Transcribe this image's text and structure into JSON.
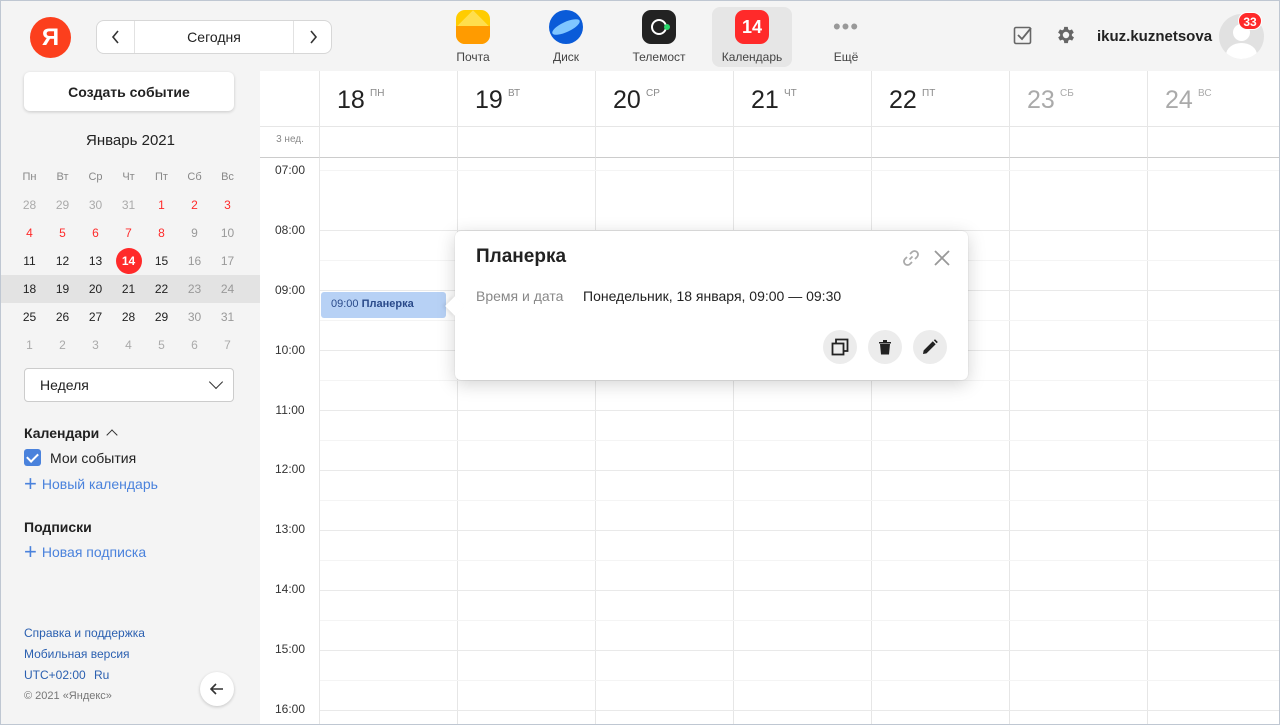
{
  "header": {
    "logo": "Я",
    "today_label": "Сегодня",
    "apps": [
      {
        "label": "Почта",
        "icon": "mail-icon"
      },
      {
        "label": "Диск",
        "icon": "disk-icon"
      },
      {
        "label": "Телемост",
        "icon": "telemost-icon"
      },
      {
        "label": "Календарь",
        "icon": "calendar-icon",
        "icon_text": "14",
        "active": true
      },
      {
        "label": "Ещё",
        "icon": "more-icon",
        "icon_text": "•••"
      }
    ],
    "username": "ikuz.kuznetsova",
    "notifications": "33"
  },
  "sidebar": {
    "create_button": "Создать событие",
    "month_title": "Январь 2021",
    "weekdays": [
      "Пн",
      "Вт",
      "Ср",
      "Чт",
      "Пт",
      "Сб",
      "Вс"
    ],
    "weeks": [
      [
        "28",
        "29",
        "30",
        "31",
        "1",
        "2",
        "3"
      ],
      [
        "4",
        "5",
        "6",
        "7",
        "8",
        "9",
        "10"
      ],
      [
        "11",
        "12",
        "13",
        "14",
        "15",
        "16",
        "17"
      ],
      [
        "18",
        "19",
        "20",
        "21",
        "22",
        "23",
        "24"
      ],
      [
        "25",
        "26",
        "27",
        "28",
        "29",
        "30",
        "31"
      ],
      [
        "1",
        "2",
        "3",
        "4",
        "5",
        "6",
        "7"
      ]
    ],
    "view_select": "Неделя",
    "calendars_title": "Календари",
    "my_events": "Мои события",
    "new_calendar": "Новый календарь",
    "subscriptions_title": "Подписки",
    "new_subscription": "Новая подписка",
    "footer": {
      "help": "Справка и поддержка",
      "mobile": "Мобильная версия",
      "timezone": "UTC+02:00",
      "lang": "Ru",
      "copyright": "© 2021 «Яндекс»"
    }
  },
  "week": {
    "week_label": "3 нед.",
    "days": [
      {
        "num": "18",
        "dow": "ПН"
      },
      {
        "num": "19",
        "dow": "ВТ"
      },
      {
        "num": "20",
        "dow": "СР"
      },
      {
        "num": "21",
        "dow": "ЧТ"
      },
      {
        "num": "22",
        "dow": "ПТ"
      },
      {
        "num": "23",
        "dow": "СБ",
        "weekend": true
      },
      {
        "num": "24",
        "dow": "ВС",
        "weekend": true
      }
    ],
    "times": [
      "07:00",
      "08:00",
      "09:00",
      "10:00",
      "11:00",
      "12:00",
      "13:00",
      "14:00",
      "15:00",
      "16:00"
    ]
  },
  "event": {
    "time": "09:00",
    "title": "Планерка"
  },
  "popup": {
    "title": "Планерка",
    "label": "Время и дата",
    "value": "Понедельник, 18 января, 09:00 — 09:30"
  },
  "colors": {
    "accent_red": "#ff2a2a",
    "link_blue": "#4a82dc",
    "event_blue": "#b7d1f5"
  }
}
